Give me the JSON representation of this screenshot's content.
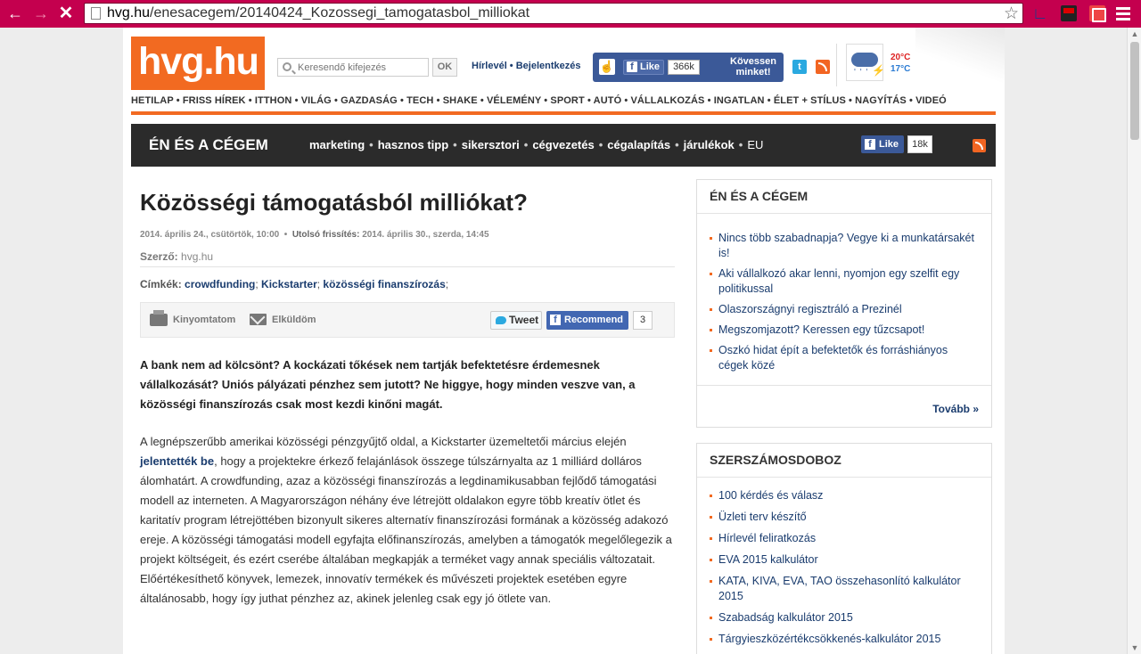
{
  "browser": {
    "url_domain": "hvg.hu",
    "url_path": "/enesacegem/20140424_Kozossegi_tamogatasbol_milliokat"
  },
  "header": {
    "logo": "hvg.hu",
    "search_placeholder": "Keresendő kifejezés",
    "search_button": "OK",
    "link_newsletter": "Hírlevél",
    "link_login": "Bejelentkezés",
    "fb_like": "Like",
    "fb_count": "366k",
    "fb_follow": "Kövessen minket!",
    "temp_high": "20°C",
    "temp_low": "17°C"
  },
  "main_nav": [
    "HETILAP",
    "FRISS HÍREK",
    "ITTHON",
    "VILÁG",
    "GAZDASÁG",
    "TECH",
    "SHAKE",
    "VÉLEMÉNY",
    "SPORT",
    "AUTÓ",
    "VÁLLALKOZÁS",
    "INGATLAN",
    "ÉLET + STÍLUS",
    "NAGYÍTÁS",
    "VIDEÓ"
  ],
  "section": {
    "title": "ÉN ÉS A CÉGEM",
    "menu": [
      "marketing",
      "hasznos tipp",
      "sikersztori",
      "cégvezetés",
      "cégalapítás",
      "járulékok",
      "EU"
    ],
    "fb_like": "Like",
    "fb_count": "18k"
  },
  "article": {
    "title": "Közösségi támogatásból milliókat?",
    "date": "2014. április 24., csütörtök, 10:00",
    "updated_label": "Utolsó frissítés:",
    "updated": "2014. április 30., szerda, 14:45",
    "author_label": "Szerző:",
    "author": "hvg.hu",
    "tags_label": "Címkék:",
    "tags": [
      "crowdfunding",
      "Kickstarter",
      "közösségi finanszírozás"
    ],
    "print_label": "Kinyomtatom",
    "mail_label": "Elküldöm",
    "tweet_label": "Tweet",
    "recommend_label": "Recommend",
    "recommend_count": "3",
    "lead": "A bank nem ad kölcsönt? A kockázati tőkések nem tartják befektetésre érdemesnek vállalkozását? Uniós pályázati pénzhez sem jutott? Ne higgye, hogy minden veszve van, a közösségi finanszírozás csak most kezdi kinőni magát.",
    "body_1": "A legnépszerűbb amerikai közösségi pénzgyűjtő oldal, a Kickstarter üzemeltetői március elején",
    "body_link": "jelentették be",
    "body_2": ", hogy a projektekre érkező felajánlások összege túlszárnyalta az 1 milliárd dolláros álomhatárt. A crowdfunding, azaz a közösségi finanszírozás a legdinamikusabban fejlődő támogatási modell az interneten. A Magyarországon néhány éve létrejött oldalakon egyre több kreatív ötlet és karitatív program létrejöttében bizonyult sikeres alternatív finanszírozási formának a közösség adakozó ereje. A közösségi támogatási modell egyfajta előfinanszírozás, amelyben a támogatók megelőlegezik a projekt költségeit, és ezért cserébe általában megkapják a terméket vagy annak speciális változatait. Előértékesíthető könyvek, lemezek, innovatív termékek és művészeti projektek esetében egyre általánosabb, hogy így juthat pénzhez az, akinek jelenleg csak egy jó ötlete van."
  },
  "sidebar": {
    "box1_title": "ÉN ÉS A CÉGEM",
    "box1_items": [
      "Nincs több szabadnapja? Vegye ki a munkatársakét is!",
      "Aki vállalkozó akar lenni, nyomjon egy szelfit egy politikussal",
      "Olaszországnyi regisztráló a Prezinél",
      "Megszomjazott? Keressen egy tűzcsapot!",
      "Oszkó hidat épít a befektetők és forráshiányos cégek közé"
    ],
    "box1_more": "Tovább »",
    "box2_title": "SZERSZÁMOSDOBOZ",
    "box2_items": [
      "100 kérdés és válasz",
      "Üzleti terv készítő",
      "Hírlevél feliratkozás",
      "EVA 2015 kalkulátor",
      "KATA, KIVA, EVA, TAO összehasonlító kalkulátor 2015",
      "Szabadság kalkulátor 2015",
      "Tárgyieszközértékcsökkenés-kalkulátor 2015"
    ]
  },
  "colors": {
    "chrome": "#c4004e",
    "brand_orange": "#f26a21",
    "facebook": "#3b5998",
    "link": "#1a3c6e"
  },
  "icons": [
    "back-icon",
    "forward-icon",
    "stop-icon",
    "star-icon",
    "search-icon",
    "twitter-icon",
    "rss-icon",
    "weather-storm-icon",
    "printer-icon",
    "mail-icon"
  ]
}
